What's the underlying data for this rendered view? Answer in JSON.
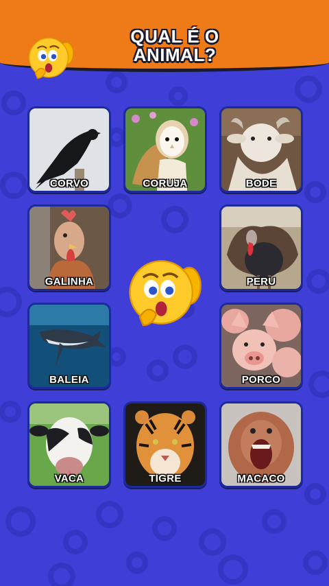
{
  "header": {
    "title_line1": "QUAL É O",
    "title_line2": "ANIMAL?"
  },
  "colors": {
    "background": "#3f3fd8",
    "header": "#ef7a18",
    "card_border": "#1c2a9c"
  },
  "cards": [
    {
      "label": "CORVO"
    },
    {
      "label": "CORUJA"
    },
    {
      "label": "BODE"
    },
    {
      "label": "GALINHA"
    },
    {
      "label": "PERU"
    },
    {
      "label": "BALEIA"
    },
    {
      "label": "PORCO"
    },
    {
      "label": "VACA"
    },
    {
      "label": "TIGRE"
    },
    {
      "label": "MACACO"
    }
  ],
  "icons": {
    "header_emoji": "thinking-face-icon",
    "center_emoji": "thinking-face-icon"
  }
}
